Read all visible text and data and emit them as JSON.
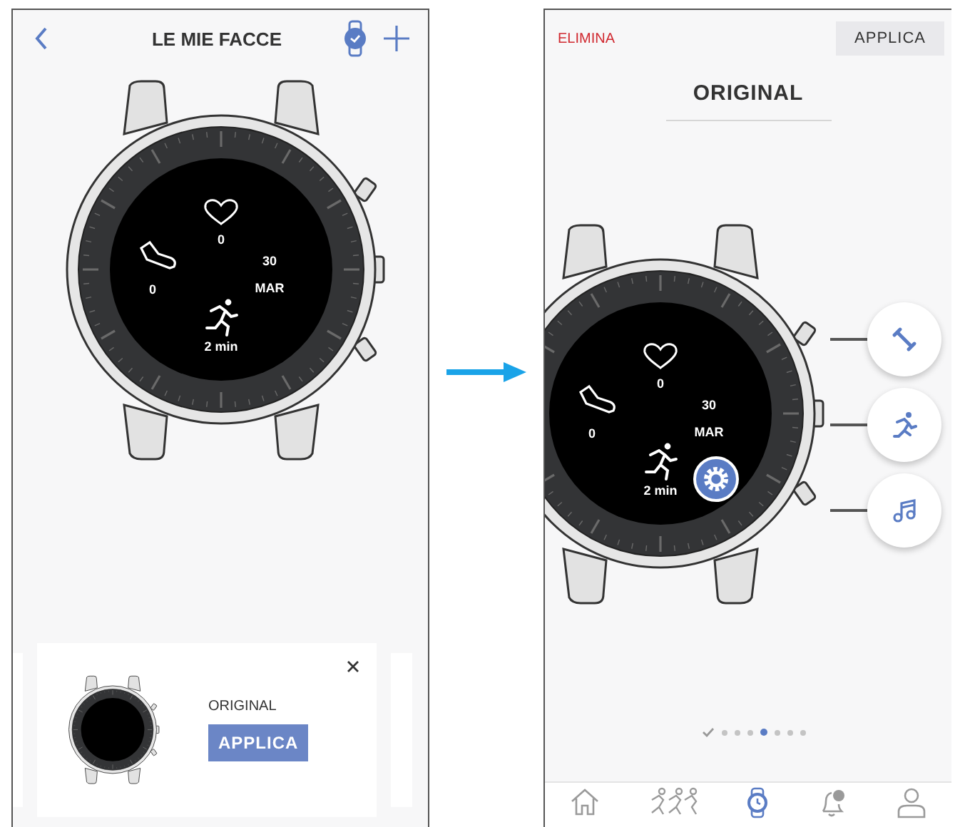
{
  "left_screen": {
    "title": "LE MIE FACCE",
    "watch_face": {
      "heart": "0",
      "steps": "0",
      "day": "30",
      "month": "MAR",
      "activity": "2 min"
    },
    "card": {
      "name": "ORIGINAL",
      "apply_button": "APPLICA"
    }
  },
  "right_screen": {
    "delete_button": "ELIMINA",
    "apply_button": "APPLICA",
    "face_name": "ORIGINAL",
    "watch_face": {
      "heart": "0",
      "steps": "0",
      "day": "30",
      "month": "MAR",
      "activity": "2 min"
    },
    "shortcuts": [
      {
        "kind": "workout"
      },
      {
        "kind": "run"
      },
      {
        "kind": "music"
      }
    ],
    "page_dots": [
      {
        "kind": "check",
        "selected": false
      },
      {
        "kind": "dot",
        "selected": false
      },
      {
        "kind": "dot",
        "selected": false
      },
      {
        "kind": "dot",
        "selected": false
      },
      {
        "kind": "dot",
        "selected": true
      },
      {
        "kind": "dot",
        "selected": false
      },
      {
        "kind": "dot",
        "selected": false
      },
      {
        "kind": "dot",
        "selected": false
      }
    ],
    "tab_bar": [
      {
        "kind": "home",
        "selected": false
      },
      {
        "kind": "challenge",
        "selected": false
      },
      {
        "kind": "watch",
        "selected": true
      },
      {
        "kind": "alerts",
        "selected": false
      },
      {
        "kind": "profile",
        "selected": false
      }
    ]
  }
}
